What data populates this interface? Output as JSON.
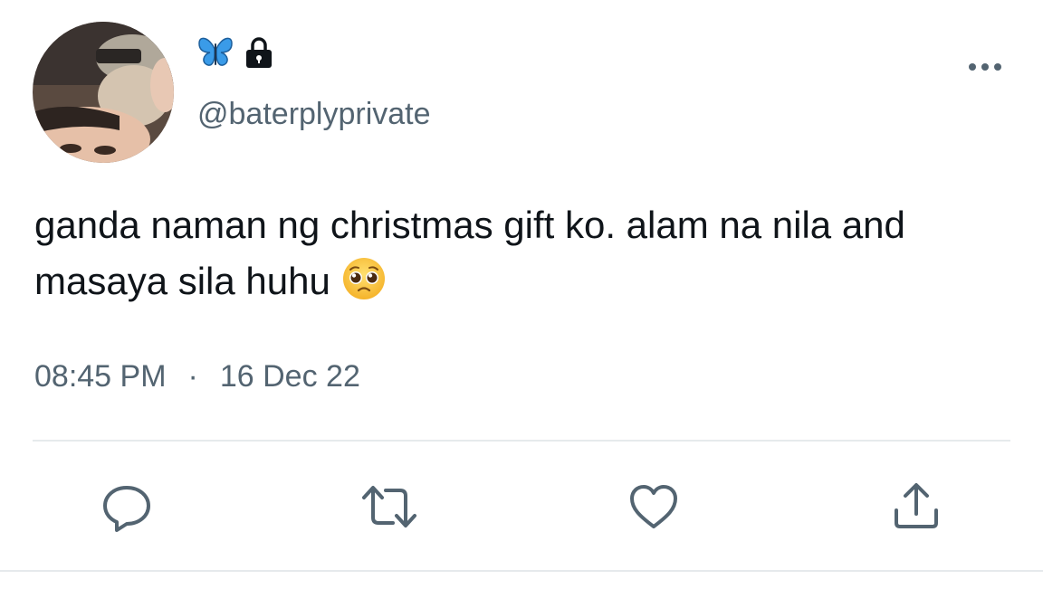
{
  "header": {
    "display_name_icons": [
      "butterfly-icon",
      "lock-icon"
    ],
    "handle": "@baterplyprivate",
    "more_icon": "more-icon"
  },
  "tweet": {
    "text": "ganda naman ng christmas gift ko. alam na nila and masaya sila huhu",
    "emoji": "pleading-face-emoji"
  },
  "meta": {
    "time": "08:45 PM",
    "separator": "·",
    "date": "16 Dec 22"
  },
  "actions": [
    {
      "icon": "reply-icon"
    },
    {
      "icon": "retweet-icon"
    },
    {
      "icon": "like-icon"
    },
    {
      "icon": "share-icon"
    }
  ],
  "colors": {
    "text_primary": "#0f1419",
    "text_secondary": "#536471",
    "icon": "#536471",
    "butterfly": "#2f8fe0"
  }
}
